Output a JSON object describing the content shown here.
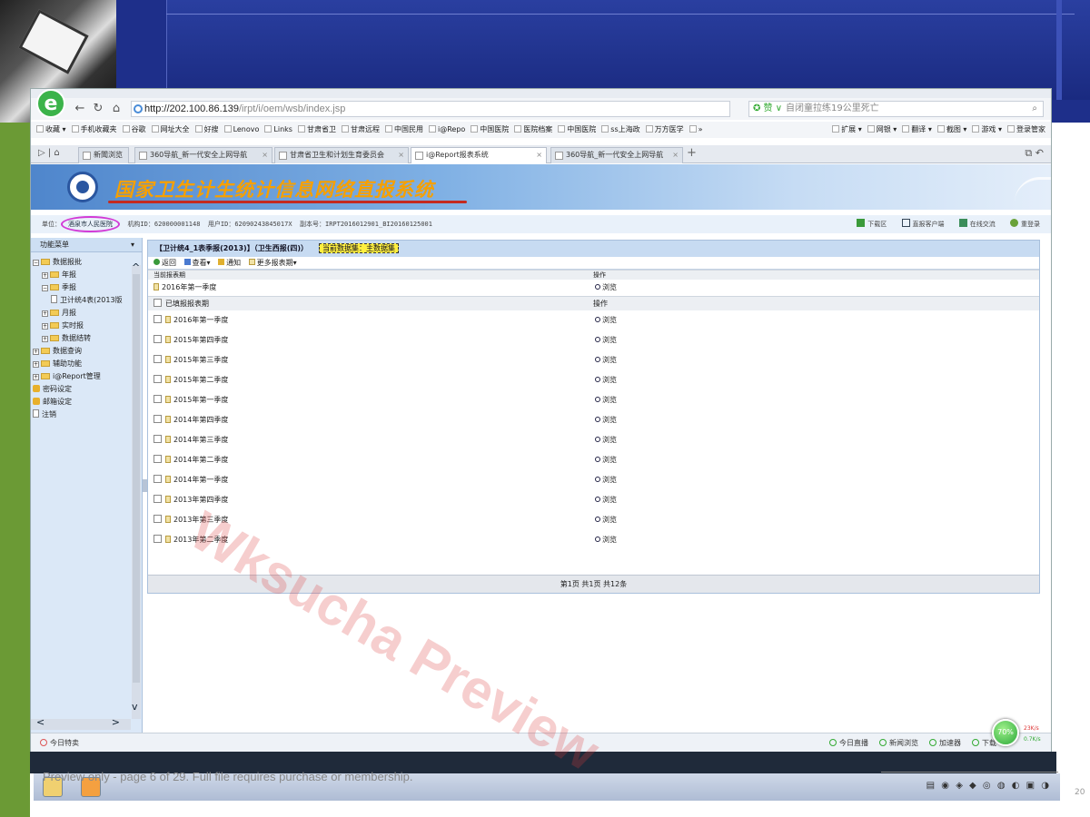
{
  "browser": {
    "logo_glyph": "e",
    "url_host": "http://202.100.86.139",
    "url_path": "/irpt/i/oem/wsb/index.jsp",
    "search_placeholder": "自闭童拉练19公里死亡",
    "search_tools": "✪ 赞  ∨",
    "bookmarks_left": [
      "收藏 ▾",
      "手机收藏夹",
      "谷歌",
      "网址大全",
      "好搜",
      "Lenovo",
      "Links",
      "甘肃省卫",
      "甘肃远程",
      "中国民用",
      "i@Repo",
      "中国医院",
      "医院档案",
      "中国医院",
      "ss上海政",
      "万方医学",
      "»"
    ],
    "bookmarks_right": [
      "扩展 ▾",
      "网银 ▾",
      "翻译 ▾",
      "截图 ▾",
      "游戏 ▾",
      "登录管家"
    ],
    "tabs": [
      {
        "label": "新聞浏览",
        "active": false
      },
      {
        "label": "360导航_新一代安全上网导航",
        "active": false
      },
      {
        "label": "甘肃省卫生和计划生育委员会",
        "active": false
      },
      {
        "label": "i@Report报表系统",
        "active": true
      },
      {
        "label": "360导航_新一代安全上网导航",
        "active": false
      }
    ],
    "new_tab": "+"
  },
  "system": {
    "title": "国家卫生计生统计信息网络直报系统",
    "unit_label": "单位：",
    "unit_name": "酒泉市人民医院",
    "org_id": "机构ID：620000001148",
    "user_id": "用户ID：62090243845017X",
    "copy_no": "副本号：IRPT2016012901_BI20160125001",
    "links": [
      "下载区",
      "直报客户端",
      "在线交流",
      "重登录"
    ]
  },
  "sidebar": {
    "menu_title": "功能菜单",
    "tree": [
      {
        "level": 0,
        "type": "folder",
        "exp": "−",
        "label": "数据报批"
      },
      {
        "level": 1,
        "type": "folder",
        "exp": "+",
        "label": "年报"
      },
      {
        "level": 1,
        "type": "folder",
        "exp": "−",
        "label": "季报"
      },
      {
        "level": 2,
        "type": "doc",
        "exp": "",
        "label": "卫计统4表(2013版"
      },
      {
        "level": 1,
        "type": "folder",
        "exp": "+",
        "label": "月报"
      },
      {
        "level": 1,
        "type": "folder",
        "exp": "+",
        "label": "实时报"
      },
      {
        "level": 1,
        "type": "folder",
        "exp": "+",
        "label": "数据结转"
      },
      {
        "level": 0,
        "type": "folder",
        "exp": "+",
        "label": "数据查询"
      },
      {
        "level": 0,
        "type": "folder",
        "exp": "+",
        "label": "辅助功能"
      },
      {
        "level": 0,
        "type": "folder",
        "exp": "+",
        "label": "i@Report管理"
      },
      {
        "level": 0,
        "type": "lock",
        "exp": "",
        "label": "密码设定"
      },
      {
        "level": 0,
        "type": "lock",
        "exp": "",
        "label": "邮箱设定"
      },
      {
        "level": 0,
        "type": "doc",
        "exp": "",
        "label": "注销"
      }
    ]
  },
  "content": {
    "header_title": "【卫计统4_1表季报(2013)】（卫生西报(四)）",
    "header_highlight": "当前数据集：主数据集",
    "toolbar": [
      "返回",
      "查看▾",
      "通知",
      "更多报表期▾"
    ],
    "current_section": {
      "col1": "当前报表期",
      "col2": "操作"
    },
    "current_row": {
      "period": "2016年第一季度",
      "action": "浏览"
    },
    "submitted_section": {
      "col1": "已填报报表期",
      "col2": "操作"
    },
    "submitted_rows": [
      {
        "period": "2016年第一季度",
        "action": "浏览"
      },
      {
        "period": "2015年第四季度",
        "action": "浏览"
      },
      {
        "period": "2015年第三季度",
        "action": "浏览"
      },
      {
        "period": "2015年第二季度",
        "action": "浏览"
      },
      {
        "period": "2015年第一季度",
        "action": "浏览"
      },
      {
        "period": "2014年第四季度",
        "action": "浏览"
      },
      {
        "period": "2014年第三季度",
        "action": "浏览"
      },
      {
        "period": "2014年第二季度",
        "action": "浏览"
      },
      {
        "period": "2014年第一季度",
        "action": "浏览"
      },
      {
        "period": "2013年第四季度",
        "action": "浏览"
      },
      {
        "period": "2013年第三季度",
        "action": "浏览"
      },
      {
        "period": "2013年第二季度",
        "action": "浏览"
      }
    ],
    "pager": "第1页 共1页 共12条"
  },
  "statusbar": {
    "left": "今日特卖",
    "right_items": [
      "今日直播",
      "新闻浏览",
      "加速器",
      "下载"
    ],
    "speed_percent": "70%",
    "upload": "23K/s",
    "download": "0.7K/s"
  },
  "footer": {
    "preview_note": "Preview only - page 6 of 29. Full file requires purchase or membership.",
    "year_fragment": "20"
  },
  "watermark": "Wksucha Preview"
}
